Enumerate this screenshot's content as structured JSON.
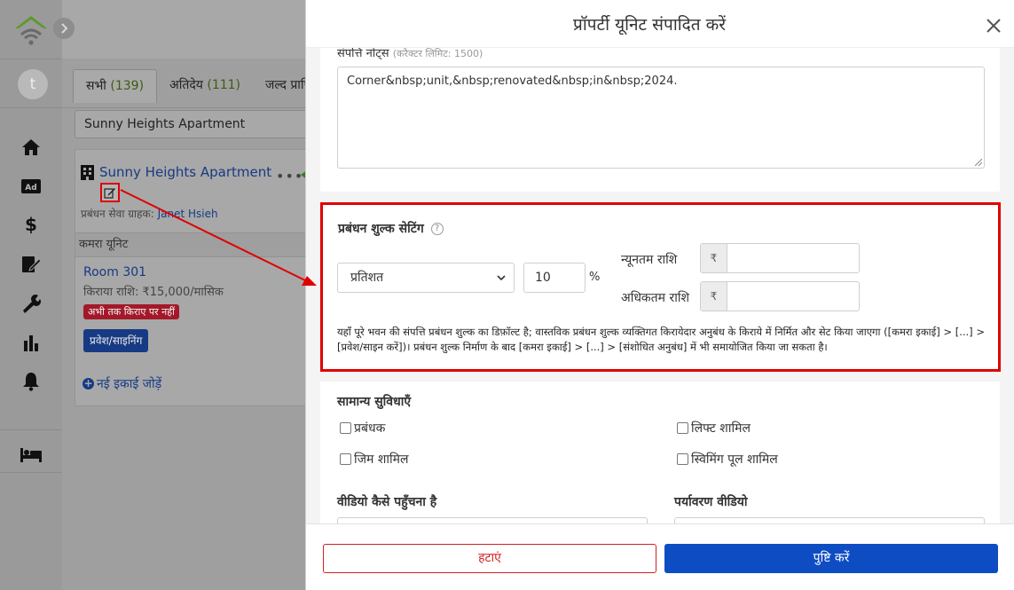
{
  "sidebar": {
    "avatar_initial": "t",
    "items": [
      {
        "name": "home-icon"
      },
      {
        "name": "ad-icon",
        "label": "Ad"
      },
      {
        "name": "dollar-icon",
        "label": "$"
      },
      {
        "name": "contract-edit-icon"
      },
      {
        "name": "wrench-icon"
      },
      {
        "name": "bar-chart-icon"
      },
      {
        "name": "bell-icon"
      },
      {
        "name": "bed-icon"
      }
    ]
  },
  "page": {
    "tabs": [
      {
        "label": "सभी",
        "count": "(139)"
      },
      {
        "label": "अतिदेय",
        "count": "(111)"
      },
      {
        "label": "जल्द प्राप्ति",
        "count": ""
      }
    ],
    "search_value": "Sunny Heights Apartment",
    "property": {
      "title": "Sunny Heights Apartment",
      "dots": "•••",
      "manager_label": "प्रबंधन सेवा ग्राहक:",
      "manager_name": "Janet Hsieh"
    },
    "units_header": "कमरा यूनिट",
    "room": {
      "name": "Room 301",
      "rent": "किराया राशि: ₹15,000/मासिक",
      "badge": "अभी तक किराए पर नहीं",
      "action": "प्रवेश/साइनिंग"
    },
    "add_unit": "नई इकाई जोड़ें"
  },
  "modal": {
    "title": "प्रॉपर्टी यूनिट संपादित करें",
    "notes_label": "संपत्ति नोट्स",
    "notes_hint": "(करैक्टर लिमिट: 1500)",
    "notes_value": "Corner&nbsp;unit,&nbsp;renovated&nbsp;in&nbsp;2024.",
    "fee": {
      "title": "प्रबंधन शुल्क सेटिंग",
      "help": "?",
      "type_value": "प्रतिशत",
      "percent_value": "10",
      "percent_sign": "%",
      "min_label": "न्यूनतम राशि",
      "max_label": "अधिकतम राशि",
      "currency": "₹",
      "note": "यहाँ पूरे भवन की संपत्ति प्रबंधन शुल्क का डिफ़ॉल्ट है; वास्तविक प्रबंधन शुल्क व्यक्तिगत किरायेदार अनुबंध के किराये में निर्मित और सेट किया जाएगा ([कमरा इकाई] > [...] > [प्रवेश/साइन करें])। प्रबंधन शुल्क निर्माण के बाद [कमरा इकाई] > [...] > [संशोधित अनुबंध] में भी समायोजित किया जा सकता है।"
    },
    "amenities": {
      "title": "सामान्य सुविधाएँ",
      "items": [
        "प्रबंधक",
        "लिफ्ट शामिल",
        "जिम शामिल",
        "स्विमिंग पूल शामिल"
      ]
    },
    "video_access_label": "वीडियो कैसे पहुँचना है",
    "video_env_label": "पर्यावरण वीडियो",
    "remove_button": "हटाएं",
    "confirm_button": "पुष्टि करें"
  }
}
